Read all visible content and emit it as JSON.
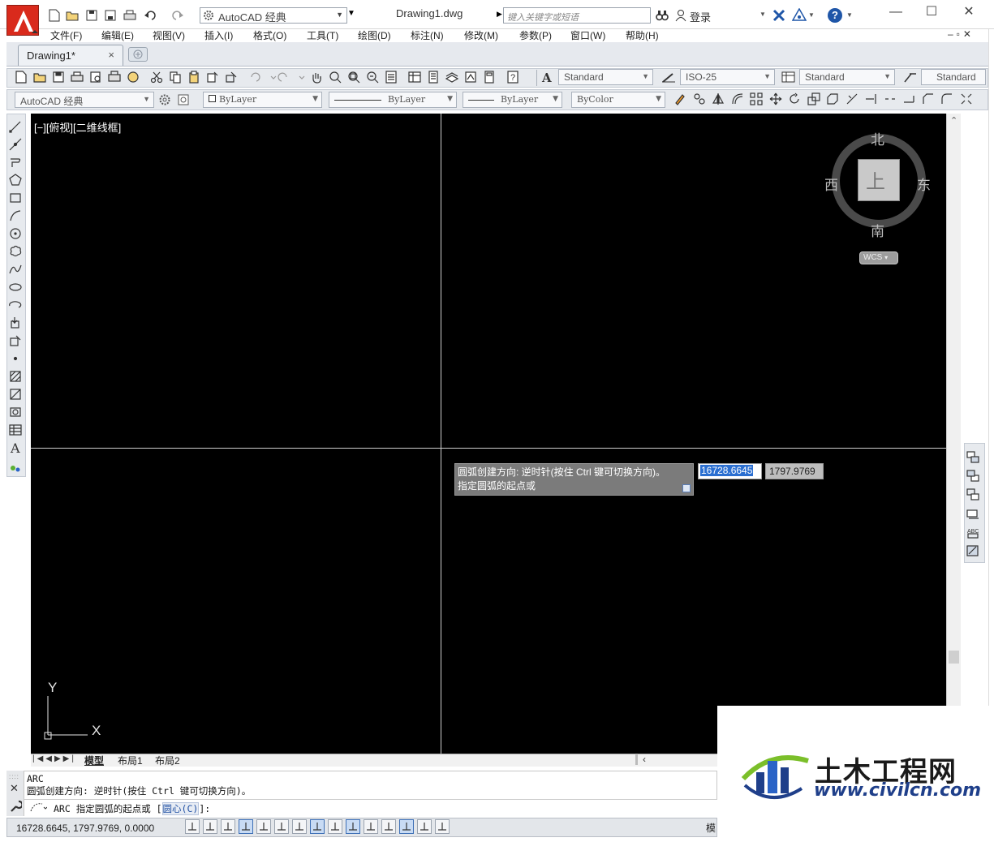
{
  "title_bar": {
    "workspace_combo": "AutoCAD 经典",
    "doc_title": "Drawing1.dwg",
    "search_placeholder": "键入关键字或短语",
    "login": "登录"
  },
  "menu": [
    "文件(F)",
    "编辑(E)",
    "视图(V)",
    "插入(I)",
    "格式(O)",
    "工具(T)",
    "绘图(D)",
    "标注(N)",
    "修改(M)",
    "参数(P)",
    "窗口(W)",
    "帮助(H)"
  ],
  "file_tab": {
    "label": "Drawing1*",
    "close": "×"
  },
  "toolbar1": {
    "text_style": "Standard",
    "dim_style": "ISO-25",
    "table_style": "Standard",
    "mleader_style": "Standard"
  },
  "toolbar2": {
    "workspace": "AutoCAD 经典",
    "layer": "ByLayer",
    "linetype": "ByLayer",
    "lineweight": "ByLayer",
    "plotstyle": "ByColor"
  },
  "viewport_label": "[−][俯视][二维线框]",
  "viewcube": {
    "north": "北",
    "south": "南",
    "east": "东",
    "west": "西",
    "top": "上",
    "wcs": "WCS"
  },
  "ucs": {
    "x": "X",
    "y": "Y"
  },
  "tooltip": {
    "line1": "圆弧创建方向: 逆时针(按住 Ctrl 键可切换方向)。",
    "line2": "指定圆弧的起点或"
  },
  "dynamic_input": {
    "x": "16728.6645",
    "y": "1797.9769"
  },
  "layout_tabs": [
    "模型",
    "布局1",
    "布局2"
  ],
  "command": {
    "line1": "ARC",
    "line2": "圆弧创建方向: 逆时针(按住 Ctrl 键可切换方向)。",
    "prompt_prefix": "ARC 指定圆弧的起点或 [",
    "prompt_option": "圆心(C)",
    "prompt_suffix": "]:"
  },
  "status": {
    "coords": "16728.6645, 1797.9769, 0.0000",
    "model": "模"
  },
  "watermark": {
    "title": "土木工程网",
    "url": "www.civilcn.com"
  },
  "colors": {
    "canvas": "#000000",
    "accent": "#2b6fd1",
    "logo_red": "#d92a1c",
    "watermark_blue": "#1f3f8a"
  }
}
